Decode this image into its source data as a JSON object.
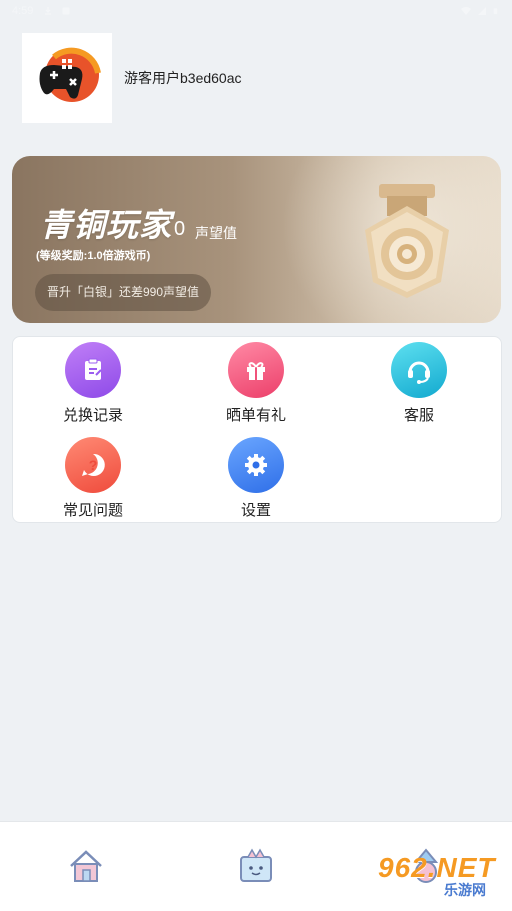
{
  "status_bar": {
    "time": "4:59"
  },
  "header": {
    "username": "游客用户b3ed60ac"
  },
  "level_card": {
    "title": "青铜玩家",
    "points": "0",
    "points_unit": "声望值",
    "bonus": "(等级奖励:1.0倍游戏币)",
    "upgrade_hint": "晋升「白银」还差990声望值"
  },
  "menu": {
    "items": [
      {
        "label": "兑换记录",
        "icon": "clipboard-icon",
        "color": "#9b5cf0"
      },
      {
        "label": "晒单有礼",
        "icon": "gift-icon",
        "color": "#f0527a"
      },
      {
        "label": "客服",
        "icon": "headset-icon",
        "color": "#1fb8d6"
      },
      {
        "label": "常见问题",
        "icon": "question-icon",
        "color": "#f25a4a"
      },
      {
        "label": "设置",
        "icon": "gear-icon",
        "color": "#3a7af0"
      }
    ]
  },
  "watermark": {
    "main": "962.NET",
    "sub": "乐游网"
  }
}
